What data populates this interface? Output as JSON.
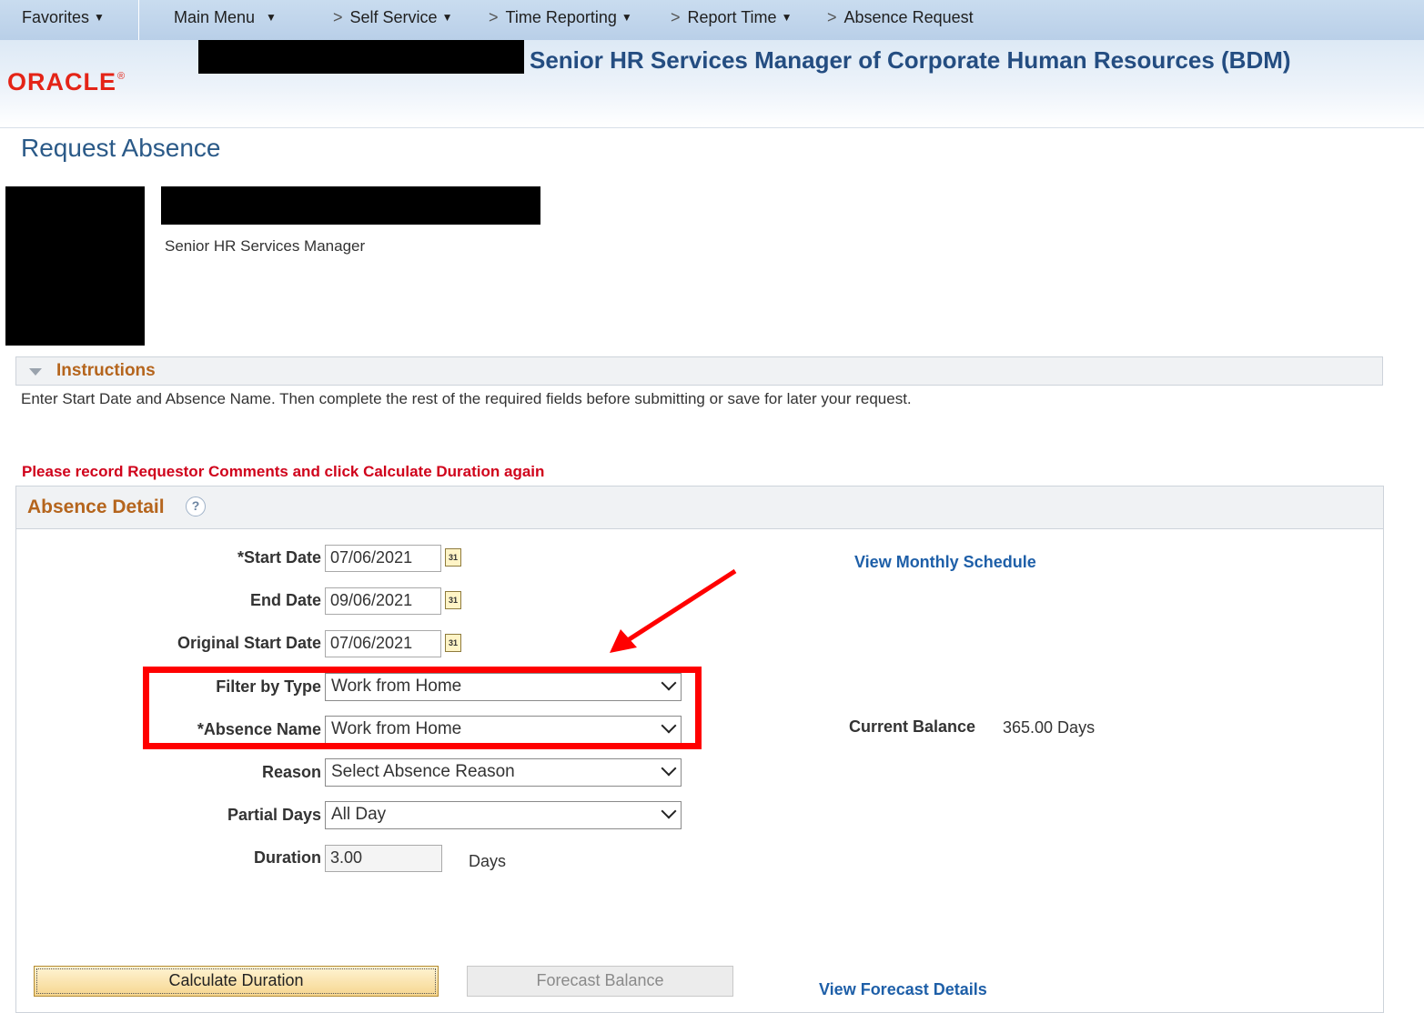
{
  "nav": {
    "favorites": "Favorites",
    "main_menu": "Main Menu",
    "breadcrumbs": [
      "Self Service",
      "Time Reporting",
      "Report Time",
      "Absence Request"
    ]
  },
  "header": {
    "logo": "ORACLE",
    "logo_mark": "®",
    "title": "Senior HR Services Manager of Corporate Human Resources (BDM)"
  },
  "page": {
    "title": "Request Absence"
  },
  "employee": {
    "job_title": "Senior HR Services Manager"
  },
  "instructions": {
    "label": "Instructions",
    "text": "Enter Start Date and Absence Name. Then complete the rest of the required fields before submitting or save for later your request."
  },
  "warning": "Please record Requestor Comments and click Calculate Duration again",
  "absence_detail": {
    "title": "Absence Detail",
    "help": "?",
    "start_date": {
      "label": "*Start Date",
      "value": "07/06/2021"
    },
    "end_date": {
      "label": "End Date",
      "value": "09/06/2021"
    },
    "original_start_date": {
      "label": "Original Start Date",
      "value": "07/06/2021"
    },
    "filter_by_type": {
      "label": "Filter by Type",
      "value": "Work from Home"
    },
    "absence_name": {
      "label": "*Absence Name",
      "value": "Work from Home"
    },
    "reason": {
      "label": "Reason",
      "value": "Select Absence Reason"
    },
    "partial_days": {
      "label": "Partial Days",
      "value": "All Day"
    },
    "duration": {
      "label": "Duration",
      "value": "3.00",
      "unit": "Days"
    },
    "calendar_icon_text": "31",
    "view_monthly_schedule": "View Monthly Schedule",
    "current_balance_label": "Current Balance",
    "current_balance_value": "365.00 Days",
    "calculate_duration": "Calculate Duration",
    "forecast_balance": "Forecast Balance",
    "view_forecast_details": "View Forecast Details"
  },
  "colors": {
    "nav_bg": "#c9dcef",
    "brand_red": "#e42417",
    "header_title": "#244d81",
    "section_orange": "#b5651d",
    "warning_red": "#d0021b",
    "link_blue": "#1e5fa8",
    "annotation_red": "#ff0000"
  }
}
